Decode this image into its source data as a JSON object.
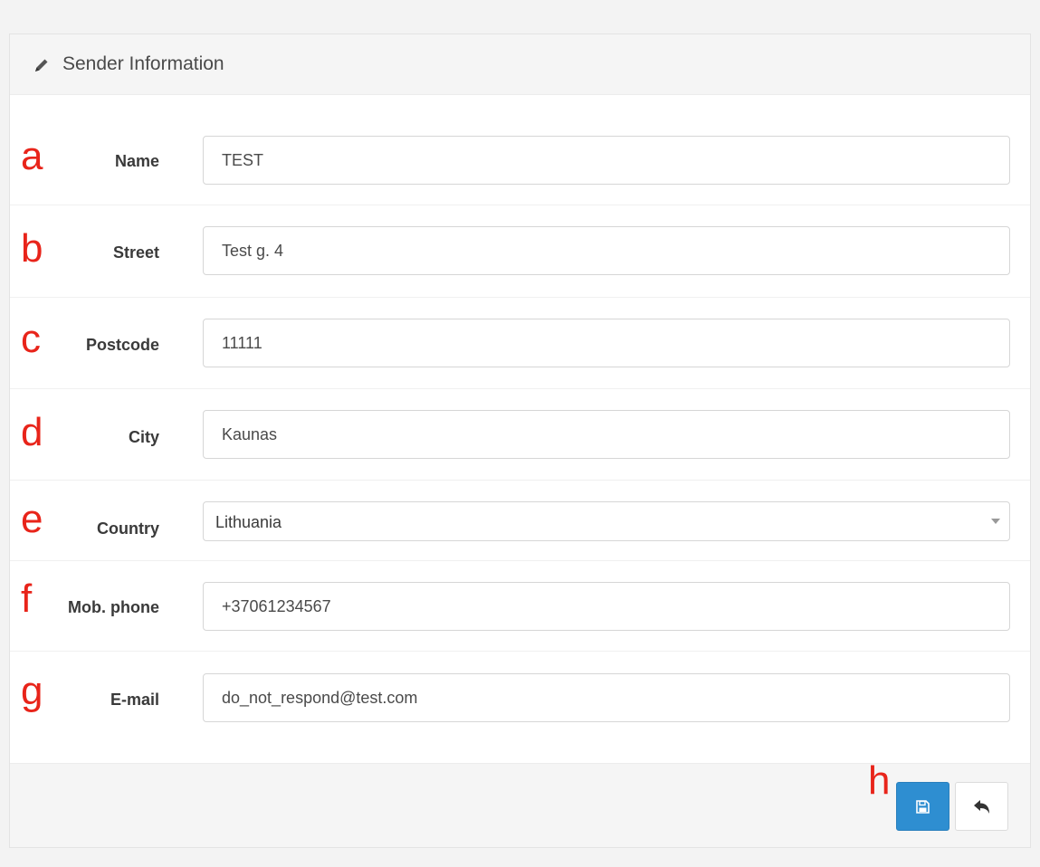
{
  "panel": {
    "title": "Sender Information"
  },
  "fields": {
    "name": {
      "marker": "a",
      "label": "Name",
      "value": "TEST"
    },
    "street": {
      "marker": "b",
      "label": "Street",
      "value": "Test g. 4"
    },
    "postcode": {
      "marker": "c",
      "label": "Postcode",
      "value": "11111"
    },
    "city": {
      "marker": "d",
      "label": "City",
      "value": "Kaunas"
    },
    "country": {
      "marker": "e",
      "label": "Country",
      "value": "Lithuania"
    },
    "phone": {
      "marker": "f",
      "label": "Mob. phone",
      "value": "+37061234567"
    },
    "email": {
      "marker": "g",
      "label": "E-mail",
      "value": "do_not_respond@test.com"
    }
  },
  "footer": {
    "marker": "h"
  },
  "icons": {
    "heading": "pencil-icon",
    "save": "floppy-disk-icon",
    "back": "reply-arrow-icon",
    "select": "caret-down-icon"
  },
  "colors": {
    "primary": "#2e8ed1",
    "annotation": "#e8241a"
  }
}
